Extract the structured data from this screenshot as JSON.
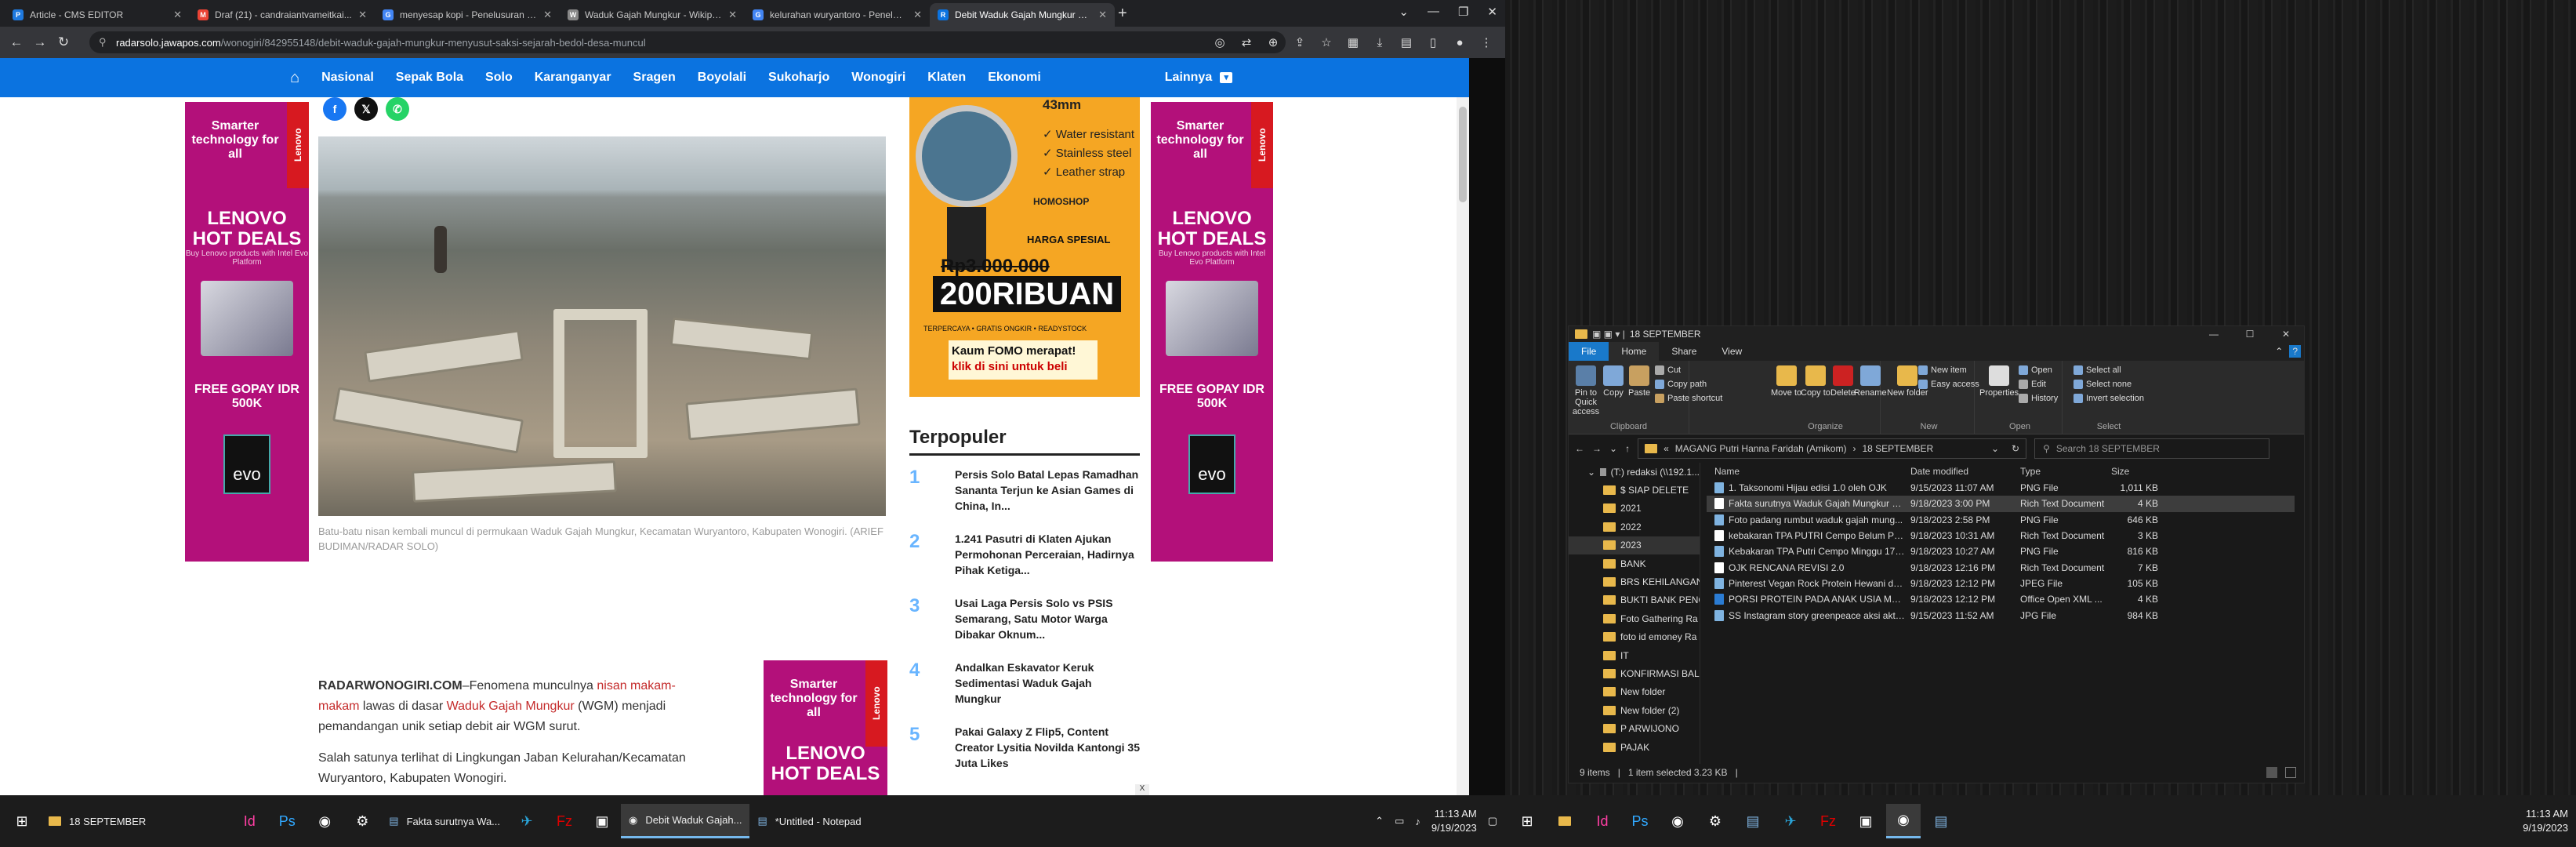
{
  "browser": {
    "tabs": [
      {
        "title": "Article - CMS EDITOR",
        "icon": "P",
        "color": "#1f7ae0"
      },
      {
        "title": "Draf (21) - candraiantvameitkai...",
        "icon": "M",
        "color": "#ea4335"
      },
      {
        "title": "menyesap kopi - Penelusuran Go...",
        "icon": "G",
        "color": "#4285f4"
      },
      {
        "title": "Waduk Gajah Mungkur - Wikipe...",
        "icon": "W",
        "color": "#888888"
      },
      {
        "title": "kelurahan wuryantoro - Penelus...",
        "icon": "G",
        "color": "#4285f4"
      },
      {
        "title": "Debit Waduk Gajah Mungkur M...",
        "icon": "R",
        "color": "#0b73e0"
      }
    ],
    "url_host": "radarsolo.jawapos.com",
    "url_path": "/wonogiri/842955148/debit-waduk-gajah-mungkur-menyusut-saksi-sejarah-bedol-desa-muncul"
  },
  "site_nav": {
    "items": [
      "Nasional",
      "Sepak Bola",
      "Solo",
      "Karanganyar",
      "Sragen",
      "Boyolali",
      "Sukoharjo",
      "Wonogiri",
      "Klaten",
      "Ekonomi",
      "Lainnya"
    ]
  },
  "ads": {
    "smart": "Smarter technology for all",
    "brand": "Lenovo",
    "hot": "LENOVO HOT DEALS",
    "hot_sub": "Buy Lenovo products with Intel Evo Platform",
    "gopay": "FREE GOPAY IDR 500K",
    "intel": "evo",
    "watch": {
      "size": "43mm",
      "spec1": "✓ Water resistant",
      "spec2": "✓ Stainless steel",
      "spec3": "✓ Leather strap",
      "shop": "HOMOSHOP",
      "harga": "HARGA SPESIAL",
      "old_price": "Rp3.000.000",
      "price": "200RIBUAN",
      "icons": "TERPERCAYA  •  GRATIS ONGKIR  •  READYSTOCK",
      "cta1": "Kaum FOMO merapat!",
      "cta2": "klik di sini untuk beli"
    }
  },
  "article": {
    "caption": "Batu-batu nisan kembali muncul di permukaan Waduk Gajah Mungkur, Kecamatan Wuryantoro, Kabupaten Wonogiri. (ARIEF BUDIMAN/RADAR SOLO)",
    "p1_a": "RADARWONOGIRI.COM",
    "p1_b": "–Fenomena munculnya ",
    "p1_link1": "nisan makam-makam",
    "p1_c": " lawas di dasar ",
    "p1_link2": "Waduk Gajah Mungkur",
    "p1_d": " (WGM) menjadi pemandangan unik setiap debit air WGM surut.",
    "p2": "Salah satunya terlihat di Lingkungan Jaban Kelurahan/Kecamatan Wuryantoro, Kabupaten Wonogiri."
  },
  "terpopuler": {
    "title": "Terpopuler",
    "items": [
      {
        "n": "1",
        "t": "Persis Solo Batal Lepas Ramadhan Sananta Terjun ke Asian Games di China, In..."
      },
      {
        "n": "2",
        "t": "1.241 Pasutri di Klaten Ajukan Permohonan Perceraian, Hadirnya Pihak Ketiga..."
      },
      {
        "n": "3",
        "t": "Usai Laga Persis Solo vs PSIS Semarang, Satu Motor Warga Dibakar Oknum..."
      },
      {
        "n": "4",
        "t": "Andalkan Eskavator Keruk Sedimentasi Waduk Gajah Mungkur"
      },
      {
        "n": "5",
        "t": "Pakai Galaxy Z Flip5, Content Creator Lysitia Novilda Kantongi 35 Juta Likes"
      }
    ]
  },
  "taskbar1": {
    "apps": [
      "18 SEPTEMBER",
      "Fakta surutnya Wa...",
      "Debit Waduk Gajah...",
      "*Untitled - Notepad"
    ],
    "time": "11:13 AM",
    "date": "9/19/2023"
  },
  "explorer": {
    "title": "18 SEPTEMBER",
    "menu": [
      "File",
      "Home",
      "Share",
      "View"
    ],
    "ribbon": {
      "pin": "Pin to Quick access",
      "copy": "Copy",
      "paste": "Paste",
      "cut": "Cut",
      "copy_path": "Copy path",
      "paste_shortcut": "Paste shortcut",
      "move": "Move to",
      "copy_to": "Copy to",
      "delete": "Delete",
      "rename": "Rename",
      "new_folder": "New folder",
      "new_item": "New item",
      "easy_access": "Easy access",
      "properties": "Properties",
      "open": "Open",
      "edit": "Edit",
      "history": "History",
      "select_all": "Select all",
      "select_none": "Select none",
      "invert": "Invert selection",
      "g_clipboard": "Clipboard",
      "g_organize": "Organize",
      "g_new": "New",
      "g_open": "Open",
      "g_select": "Select"
    },
    "path1": "MAGANG Putri Hanna Faridah (Amikom)",
    "path2": "18 SEPTEMBER",
    "search_placeholder": "Search 18 SEPTEMBER",
    "nav": [
      "(T:) redaksi (\\\\192.1...",
      "$ SIAP DELETE",
      "2021",
      "2022",
      "2023",
      "BANK",
      "BRS KEHILANGAN",
      "BUKTI BANK PENG",
      "Foto Gathering Ra",
      "foto id emoney Ra",
      "IT",
      "KONFIRMASI BALI",
      "New folder",
      "New folder (2)",
      "P ARWIJONO",
      "PAJAK"
    ],
    "headers": [
      "Name",
      "Date modified",
      "Type",
      "Size"
    ],
    "files": [
      {
        "name": "1. Taksonomi Hijau edisi 1.0 oleh OJK",
        "date": "9/15/2023 11:07 AM",
        "type": "PNG File",
        "size": "1,011 KB",
        "color": "#7fb3e0"
      },
      {
        "name": "Fakta surutnya Waduk Gajah Mungkur W...",
        "date": "9/18/2023 3:00 PM",
        "type": "Rich Text Document",
        "size": "4 KB",
        "color": "#ffffff"
      },
      {
        "name": "Foto padang rumbut waduk gajah mung...",
        "date": "9/18/2023 2:58 PM",
        "type": "PNG File",
        "size": "646 KB",
        "color": "#7fb3e0"
      },
      {
        "name": "kebakaran TPA PUTRI Cempo Belum Pad...",
        "date": "9/18/2023 10:31 AM",
        "type": "Rich Text Document",
        "size": "3 KB",
        "color": "#ffffff"
      },
      {
        "name": "Kebakaran TPA Putri Cempo Minggu 17 S...",
        "date": "9/18/2023 10:27 AM",
        "type": "PNG File",
        "size": "816 KB",
        "color": "#7fb3e0"
      },
      {
        "name": "OJK RENCANA REVISI 2.0",
        "date": "9/18/2023 12:16 PM",
        "type": "Rich Text Document",
        "size": "7 KB",
        "color": "#ffffff"
      },
      {
        "name": "Pinterest Vegan Rock Protein Hewani dan...",
        "date": "9/18/2023 12:12 PM",
        "type": "JPEG File",
        "size": "105 KB",
        "color": "#7fb3e0"
      },
      {
        "name": "PORSI PROTEIN PADA ANAK USIA MPASI",
        "date": "9/18/2023 12:12 PM",
        "type": "Office Open XML ...",
        "size": "4 KB",
        "color": "#2b7cd3"
      },
      {
        "name": "SS Instagram story greenpeace aksi aktivi...",
        "date": "9/15/2023 11:52 AM",
        "type": "JPG File",
        "size": "984 KB",
        "color": "#7fb3e0"
      }
    ],
    "status_items": "9 items",
    "status_sel": "1 item selected  3.23 KB"
  },
  "taskbar2": {
    "time": "11:13 AM",
    "date": "9/19/2023"
  }
}
